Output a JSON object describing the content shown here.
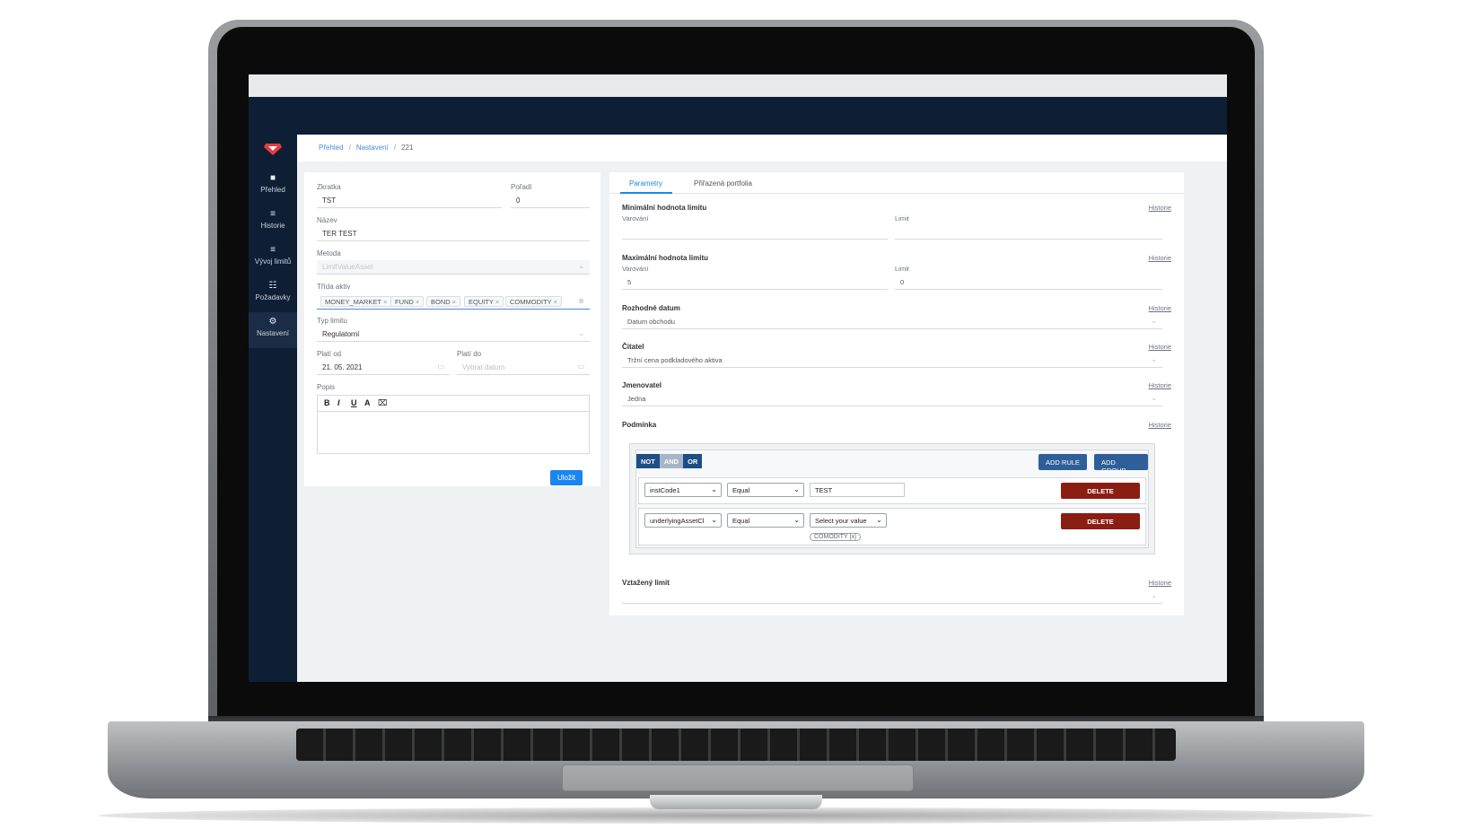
{
  "breadcrumb": [
    "Přehled",
    "Nastavení",
    "221"
  ],
  "sidebar": {
    "items": [
      {
        "icon": "square-icon",
        "label": "Přehled"
      },
      {
        "icon": "list-icon",
        "label": "Historie"
      },
      {
        "icon": "list-icon",
        "label": "Vývoj limitů"
      },
      {
        "icon": "checklist-icon",
        "label": "Požadavky"
      },
      {
        "icon": "gear-icon",
        "label": "Nastavení"
      }
    ],
    "active": "Nastavení"
  },
  "form": {
    "zkratka_label": "Zkratka",
    "zkratka_value": "TST",
    "poradi_label": "Pořadí",
    "poradi_value": "0",
    "nazev_label": "Název",
    "nazev_value": "TER TEST",
    "metoda_label": "Metoda",
    "metoda_value": "LimitValueAsset",
    "trida_label": "Třída aktiv",
    "trida_tags": [
      "MONEY_MARKET",
      "FUND",
      "BOND",
      "EQUITY",
      "COMMODITY"
    ],
    "typ_label": "Typ limitu",
    "typ_value": "Regulatorní",
    "plati_od_label": "Platí od",
    "plati_od_value": "21. 05. 2021",
    "plati_do_label": "Platí do",
    "plati_do_placeholder": "Vybrat datum",
    "popis_label": "Popis",
    "toolbar": [
      "B",
      "I",
      "U",
      "A",
      "⌧"
    ],
    "save_label": "Uložit"
  },
  "tabs": [
    "Parametry",
    "Přiřazená portfolia"
  ],
  "params": {
    "history_label": "Historie",
    "min": {
      "title": "Minimální hodnota limitu",
      "warn_label": "Varování",
      "warn_value": "",
      "limit_label": "Limit",
      "limit_value": ""
    },
    "max": {
      "title": "Maximální hodnota limitu",
      "warn_label": "Varování",
      "warn_value": "5",
      "limit_label": "Limit",
      "limit_value": "0"
    },
    "rozhodne": {
      "title": "Rozhodné datum",
      "value": "Datum obchodu"
    },
    "citatel": {
      "title": "Čitatel",
      "value": "Tržní cena podkladového aktiva"
    },
    "jmenovatel": {
      "title": "Jmenovatel",
      "value": "Jedna"
    },
    "podminka": {
      "title": "Podmínka"
    },
    "vztazeny": {
      "title": "Vztažený limit",
      "value": ""
    }
  },
  "query": {
    "combinators": [
      "NOT",
      "AND",
      "OR"
    ],
    "add_rule": "ADD RULE",
    "add_group": "ADD GROUP",
    "rules": [
      {
        "field": "instCode1",
        "operator": "Equal",
        "value": "TEST",
        "delete": "DELETE"
      },
      {
        "field": "underlyingAssetCl",
        "operator": "Equal",
        "value": "Select your value",
        "tag": "COMODITY [x]",
        "delete": "DELETE"
      }
    ]
  },
  "colors": {
    "nav": "#0e1e35",
    "accent": "#1a86f0",
    "delete": "#8b1e12",
    "query_button": "#2f5f99"
  }
}
